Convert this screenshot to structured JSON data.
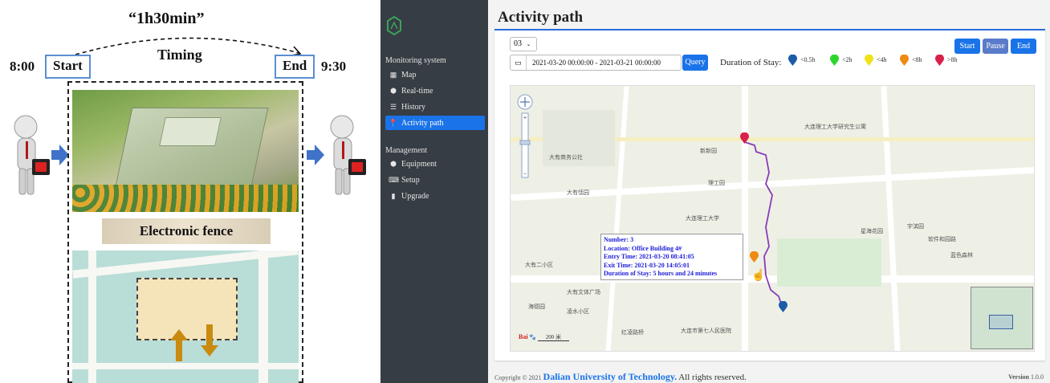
{
  "diagram": {
    "duration": "“1h30min”",
    "timing": "Timing",
    "start_time": "8:00",
    "start_label": "Start",
    "end_label": "End",
    "end_time": "9:30",
    "fence_label": "Electronic fence"
  },
  "sidebar": {
    "sections": [
      {
        "title": "Monitoring system",
        "items": [
          {
            "label": "Map",
            "icon": "grid-icon"
          },
          {
            "label": "Real-time",
            "icon": "cube-icon"
          },
          {
            "label": "History",
            "icon": "database-icon"
          },
          {
            "label": "Activity path",
            "icon": "map-pin-icon",
            "active": true
          }
        ]
      },
      {
        "title": "Management",
        "items": [
          {
            "label": "Equipment",
            "icon": "cube-icon"
          },
          {
            "label": "Setup",
            "icon": "keyboard-icon"
          },
          {
            "label": "Upgrade",
            "icon": "file-icon"
          }
        ]
      }
    ]
  },
  "main": {
    "title": "Activity path",
    "select_value": "03",
    "date_range": "2021-03-20 00:00:00 - 2021-03-21 00:00:00",
    "query_label": "Query",
    "buttons": {
      "start": "Start",
      "pause": "Pause",
      "end": "End"
    },
    "legend_title": "Duration of Stay:",
    "legend": [
      {
        "label": "<0.5h",
        "color": "#1d5aa8"
      },
      {
        "label": "<2h",
        "color": "#2fd52f"
      },
      {
        "label": "<4h",
        "color": "#f0e21a"
      },
      {
        "label": "<8h",
        "color": "#ef8a12"
      },
      {
        "label": ">8h",
        "color": "#d8204b"
      }
    ],
    "tooltip": {
      "number": "Number: 3",
      "location": "Location: Office Building 4#",
      "entry": "Entry Time: 2021-03-20 08:41:05",
      "exit": "Exit Time: 2021-03-20 14:05:01",
      "duration": "Duration of Stay: 5 hours and 24 minutes"
    },
    "scale_label": "200 米",
    "map_labels": [
      "大有商务公社",
      "大连理工大学",
      "新新园",
      "理工园",
      "大有恬园",
      "大有二小区",
      "大有文体广场",
      "凌水小区",
      "红凌路桥",
      "大连市第七人民医院",
      "大连理工大学研究生公寓",
      "星海花园",
      "软件和园路",
      "宇滨园",
      "蓝色森林",
      "海德园"
    ]
  },
  "footer": {
    "prefix": "Copyright © 2021",
    "brand": "Dalian University of Technology.",
    "rest": "All rights reserved.",
    "version_label": "Version",
    "version_num": "1.0.0"
  },
  "colors": {
    "accent": "#1a73e8",
    "sidebar_bg": "#373d44",
    "route": "#8a3bb8",
    "tooltip_text": "#1d1dd8"
  }
}
